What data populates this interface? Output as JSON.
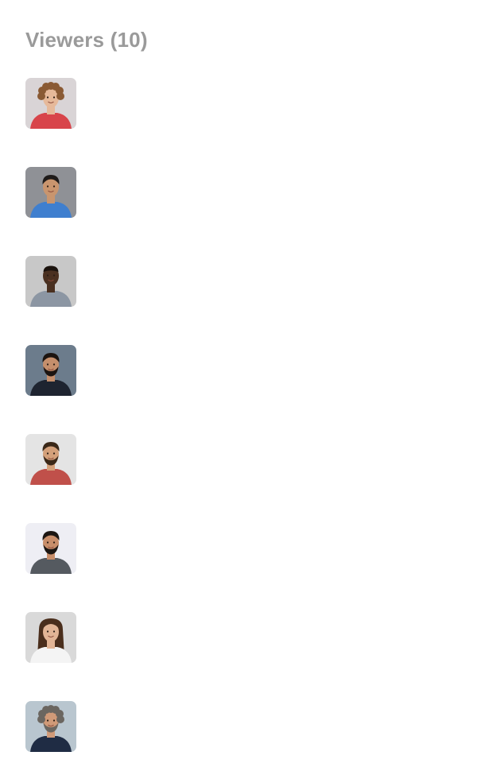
{
  "panel": {
    "title": "Viewers (10)"
  },
  "viewers": [
    {
      "avatar": "avatar-woman-curly-hair-striped-shirt",
      "bg": "#d9d4d6",
      "skin": "#e6b99a",
      "hair": "#8a5a34",
      "shirt": "#d8444a",
      "hairstyle": "curly",
      "beard": false
    },
    {
      "avatar": "avatar-man-glasses-blue-shirt",
      "bg": "#8f9196",
      "skin": "#c9956e",
      "hair": "#1e1b1a",
      "shirt": "#3f7fcf",
      "hairstyle": "short",
      "beard": false
    },
    {
      "avatar": "avatar-man-smiling-grey-shirt",
      "bg": "#c8c8c8",
      "skin": "#4a3020",
      "hair": "#1a120d",
      "shirt": "#8c96a3",
      "hairstyle": "buzz",
      "beard": false
    },
    {
      "avatar": "avatar-man-beard-dark-suit",
      "bg": "#6c7c8c",
      "skin": "#c58f6c",
      "hair": "#1c1410",
      "shirt": "#1e2430",
      "hairstyle": "short",
      "beard": true
    },
    {
      "avatar": "avatar-man-beard-plaid-shirt",
      "bg": "#e4e4e4",
      "skin": "#d3a07a",
      "hair": "#3a2818",
      "shirt": "#c0504a",
      "hairstyle": "short",
      "beard": true
    },
    {
      "avatar": "avatar-man-beard-grey-sweater",
      "bg": "#eeeef4",
      "skin": "#c88e6a",
      "hair": "#1c1612",
      "shirt": "#555a60",
      "hairstyle": "short",
      "beard": true
    },
    {
      "avatar": "avatar-woman-long-hair-white-top",
      "bg": "#d9d9d9",
      "skin": "#e2b596",
      "hair": "#4a2e1c",
      "shirt": "#f4f4f4",
      "hairstyle": "long",
      "beard": false
    },
    {
      "avatar": "avatar-man-grey-hair-navy-suit",
      "bg": "#b9c6cf",
      "skin": "#d09a78",
      "hair": "#6b6660",
      "shirt": "#1f2c44",
      "hairstyle": "curly",
      "beard": true
    }
  ]
}
